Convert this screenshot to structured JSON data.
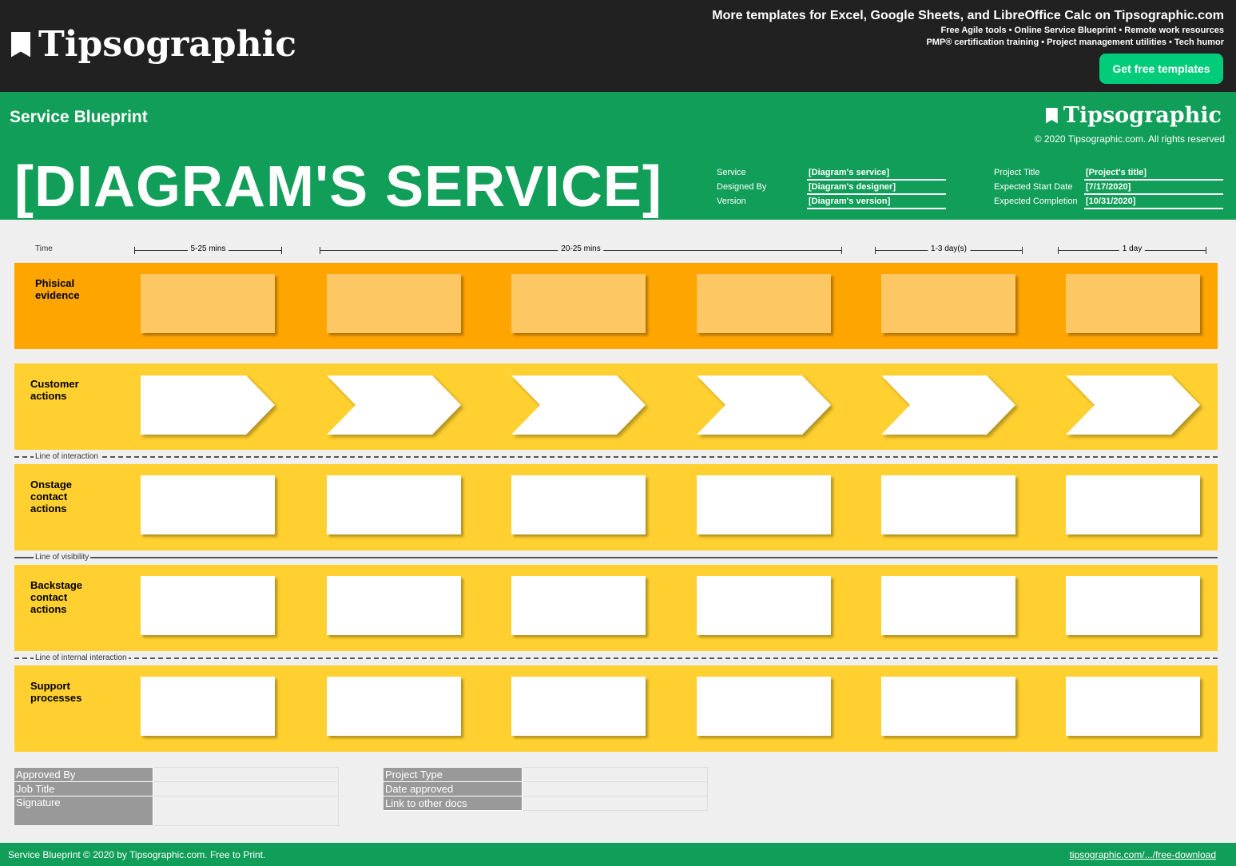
{
  "topbar": {
    "logo": "Tipsographic",
    "promo_title": "More templates for Excel,  Google Sheets, and LibreOffice Calc on Tipsographic.com",
    "promo_line1": "Free Agile tools • Online Service Blueprint • Remote work resources",
    "promo_line2": "PMP® certification training • Project management utilities • Tech humor",
    "cta": "Get free templates"
  },
  "header": {
    "subtitle": "Service Blueprint",
    "logo": "Tipsographic",
    "copyright": "© 2020 Tipsographic.com. All rights reserved",
    "title": "[DIAGRAM'S SERVICE]",
    "meta_left": [
      {
        "label": "Service",
        "value": "[Diagram's service]"
      },
      {
        "label": "Designed By",
        "value": "[Diagram's designer]"
      },
      {
        "label": "Version",
        "value": "[Diagram's version]"
      }
    ],
    "meta_right": [
      {
        "label": "Project Title",
        "value": "[Project's title]"
      },
      {
        "label": "Expected Start Date",
        "value": "[7/17/2020]"
      },
      {
        "label": "Expected Completion",
        "value": "[10/31/2020]"
      }
    ]
  },
  "timeline": {
    "label": "Time",
    "segments": [
      "5-25 mins",
      "20-25 mins",
      "1-3 day(s)",
      "1 day"
    ]
  },
  "lanes": [
    {
      "label": "Phisical\nevidence",
      "color": "#ffa500"
    },
    {
      "label": "Customer\nactions",
      "color": "#ffd02f"
    },
    {
      "label": "Onstage\ncontact\nactions",
      "color": "#ffd02f"
    },
    {
      "label": "Backstage\ncontact\nactions",
      "color": "#ffd02f"
    },
    {
      "label": "Support\nprocesses",
      "color": "#ffd02f"
    }
  ],
  "lines": {
    "interaction": "Line of interaction",
    "visibility": "Line of visibility",
    "internal": "Line of internal interaction"
  },
  "approval_left": [
    {
      "label": "Approved By",
      "value": ""
    },
    {
      "label": "Job Title",
      "value": ""
    },
    {
      "label": "Signature",
      "value": ""
    }
  ],
  "approval_right": [
    {
      "label": "Project Type",
      "value": ""
    },
    {
      "label": "Date approved",
      "value": ""
    },
    {
      "label": "Link to other docs",
      "value": ""
    }
  ],
  "footer": {
    "text": "Service Blueprint © 2020 by Tipsographic.com. Free to Print.",
    "link": "tipsographic.com/.../free-download"
  },
  "colors": {
    "topbar": "#212121",
    "brand_green": "#119e58",
    "cta": "#00cc7a",
    "orange": "#ffa500",
    "yellow": "#ffd02f",
    "card_orange": "#fdc864"
  }
}
